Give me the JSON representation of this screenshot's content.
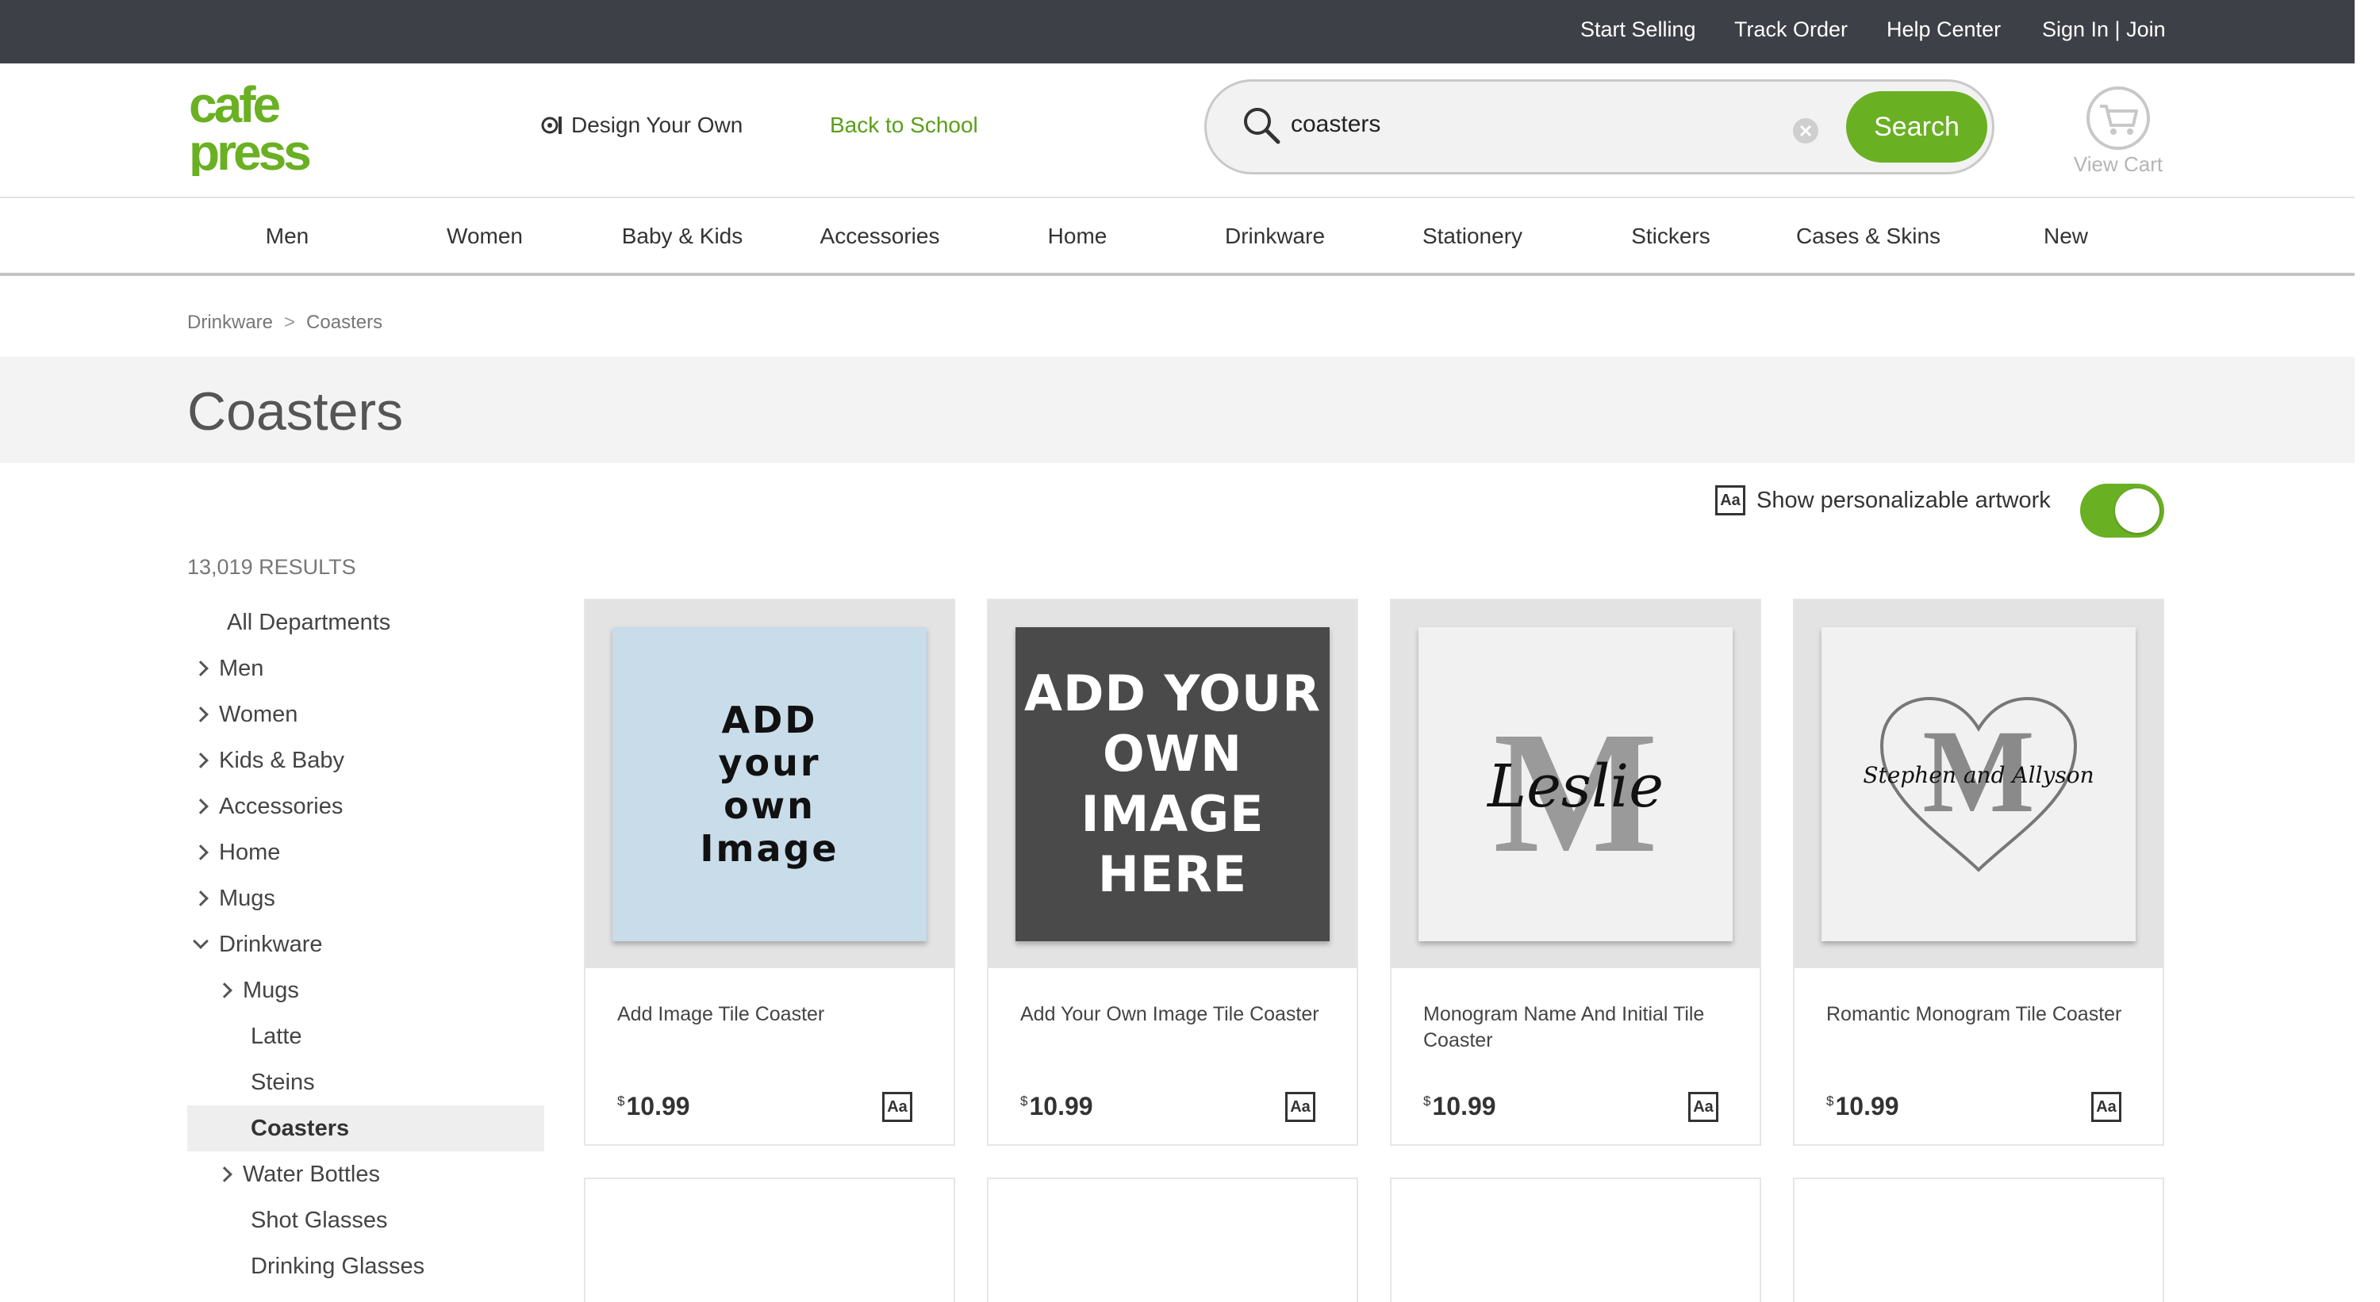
{
  "topbar": {
    "start_selling": "Start Selling",
    "track_order": "Track Order",
    "help_center": "Help Center",
    "sign_in_join": "Sign In | Join"
  },
  "header": {
    "logo_text_top": "cafe",
    "logo_text_bottom": "press",
    "design_your_own": "Design Your Own",
    "back_to_school": "Back to School",
    "search_value": "coasters",
    "search_button": "Search",
    "view_cart": "View Cart"
  },
  "catnav": [
    "Men",
    "Women",
    "Baby & Kids",
    "Accessories",
    "Home",
    "Drinkware",
    "Stationery",
    "Stickers",
    "Cases & Skins",
    "New"
  ],
  "breadcrumb": [
    "Drinkware",
    "Coasters"
  ],
  "breadcrumb_sep": ">",
  "page_title": "Coasters",
  "personalize": {
    "label": "Show personalizable artwork",
    "badge": "Aa",
    "enabled": true
  },
  "sidebar": {
    "results": "13,019 RESULTS",
    "items": [
      {
        "label": "All Departments",
        "chevron": "none"
      },
      {
        "label": "Men",
        "chevron": "right"
      },
      {
        "label": "Women",
        "chevron": "right"
      },
      {
        "label": "Kids & Baby",
        "chevron": "right"
      },
      {
        "label": "Accessories",
        "chevron": "right"
      },
      {
        "label": "Home",
        "chevron": "right"
      },
      {
        "label": "Mugs",
        "chevron": "right"
      },
      {
        "label": "Drinkware",
        "chevron": "down"
      },
      {
        "label": "Mugs",
        "chevron": "right"
      },
      {
        "label": "Latte",
        "chevron": "none"
      },
      {
        "label": "Steins",
        "chevron": "none"
      },
      {
        "label": "Coasters",
        "chevron": "none",
        "active": true
      },
      {
        "label": "Water Bottles",
        "chevron": "right"
      },
      {
        "label": "Shot Glasses",
        "chevron": "none"
      },
      {
        "label": "Drinking Glasses",
        "chevron": "none"
      }
    ]
  },
  "products": [
    {
      "name": "Add Image Tile Coaster",
      "currency": "$",
      "price": "10.99",
      "badge": "Aa",
      "art": {
        "bg": "#c8dcea",
        "lines": [
          "ADD",
          "your",
          "own",
          "Image"
        ],
        "color": "#111"
      }
    },
    {
      "name": "Add Your Own Image Tile Coaster",
      "currency": "$",
      "price": "10.99",
      "badge": "Aa",
      "art": {
        "bg": "#4a4a4a",
        "lines": [
          "ADD YOUR",
          "OWN IMAGE",
          "HERE"
        ],
        "color": "#fff"
      }
    },
    {
      "name": "Monogram Name And Initial Tile Coaster",
      "currency": "$",
      "price": "10.99",
      "badge": "Aa",
      "art": {
        "bg": "#f1f1f1",
        "initial": "M",
        "script": "Leslie"
      }
    },
    {
      "name": "Romantic Monogram Tile Coaster",
      "currency": "$",
      "price": "10.99",
      "badge": "Aa",
      "art": {
        "bg": "#f1f1f1",
        "initial": "M",
        "script": "Stephen and Allyson"
      }
    }
  ],
  "colors": {
    "topbar_bg": "#3d4046",
    "brand_green": "#6ab023",
    "link_green": "#5a9e1a",
    "title_band": "#f3f3f3"
  }
}
